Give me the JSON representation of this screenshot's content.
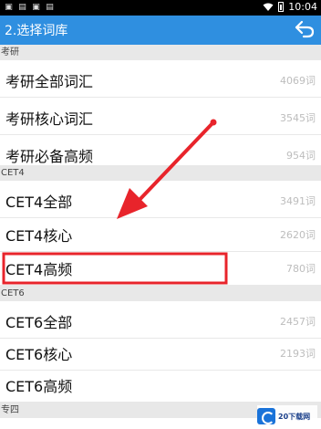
{
  "status_bar": {
    "time": "10:04"
  },
  "app_bar": {
    "title": "2.选择词库"
  },
  "sections": [
    {
      "header": "考研",
      "rows": [
        {
          "label": "考研全部词汇",
          "count": "4069词"
        },
        {
          "label": "考研核心词汇",
          "count": "3545词"
        },
        {
          "label": "考研必备高频",
          "count": "954词"
        }
      ]
    },
    {
      "header": "CET4",
      "rows": [
        {
          "label": "CET4全部",
          "count": "3491词"
        },
        {
          "label": "CET4核心",
          "count": "2620词"
        },
        {
          "label": "CET4高频",
          "count": "780词"
        }
      ]
    },
    {
      "header": "CET6",
      "rows": [
        {
          "label": "CET6全部",
          "count": "2457词"
        },
        {
          "label": "CET6核心",
          "count": "2193词"
        },
        {
          "label": "CET6高频",
          "count": ""
        }
      ]
    },
    {
      "header": "专四",
      "rows": []
    }
  ],
  "watermark": {
    "text": "20下载网"
  },
  "colors": {
    "app_bar": "#2f8fe0",
    "annotation": "#e8242b"
  }
}
